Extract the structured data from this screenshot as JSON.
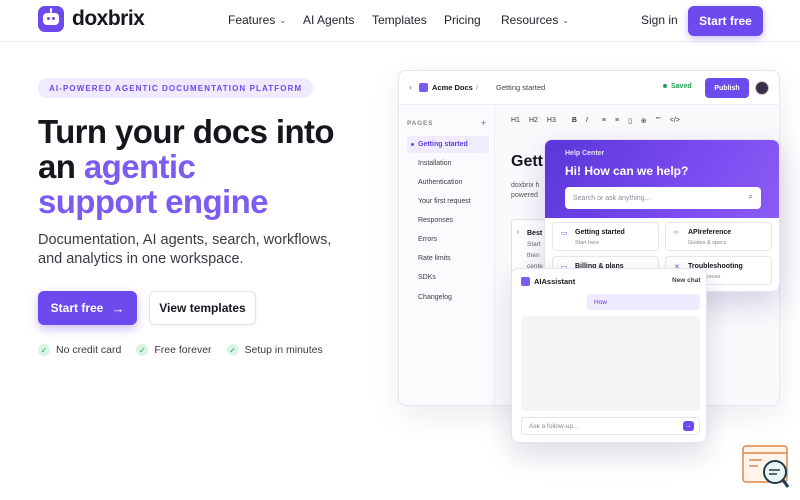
{
  "brand": {
    "name": "doxbrix",
    "accent": "#6d4aed",
    "accent_light": "#7c5cf0"
  },
  "nav": {
    "links": [
      {
        "label": "Features",
        "dropdown": true
      },
      {
        "label": "AI Agents",
        "dropdown": false
      },
      {
        "label": "Templates",
        "dropdown": false
      },
      {
        "label": "Pricing",
        "dropdown": false
      },
      {
        "label": "Resources",
        "dropdown": true
      }
    ],
    "signin": "Sign in",
    "cta": "Start free"
  },
  "hero": {
    "badge": "AI-POWERED AGENTIC DOCUMENTATION PLATFORM",
    "headline_1": "Turn your docs into",
    "headline_2a": "an ",
    "headline_2b": "agentic",
    "headline_3": "support engine",
    "subtitle": "Documentation, AI agents, search, workflows, and analytics in one workspace.",
    "primary_button": "Start free",
    "secondary_button": "View templates",
    "checks": [
      "No credit card",
      "Free forever",
      "Setup in minutes"
    ]
  },
  "editor": {
    "workspace": "Acme Docs",
    "separator": "/",
    "breadcrumb": "Getting started",
    "status": "Saved",
    "publish": "Publish",
    "pages_label": "PAGES",
    "pages": [
      "Getting started",
      "Installation",
      "Authentication",
      "Your first request",
      "Responses",
      "Errors",
      "Rate limits",
      "SDKs",
      "Changelog"
    ],
    "toolbar": [
      "H1",
      "H2",
      "H3",
      "B",
      "I",
      "≡",
      "≡",
      "▯",
      "⊕",
      "\"\"",
      "</>"
    ],
    "doc_title": "Getti",
    "doc_lines": [
      "doxbrix h",
      "powered"
    ],
    "card_title": "Best",
    "card_lines": [
      "Start",
      "then",
      "cente"
    ]
  },
  "help_center": {
    "label": "Help Center",
    "title": "Hi! How can we help?",
    "search_placeholder": "Search or ask anything...",
    "cards": [
      {
        "title": "Getting started",
        "subtitle": "Start here",
        "icon": "doc-icon"
      },
      {
        "title": "APIreference",
        "subtitle": "Guides & specs",
        "icon": "code-icon"
      },
      {
        "title": "Billing & plans",
        "subtitle": "",
        "icon": "card-icon"
      },
      {
        "title": "Troubleshooting",
        "subtitle": "mmon issues",
        "icon": "wrench-icon"
      }
    ]
  },
  "ai_assistant": {
    "title": "AIAssistant",
    "new_chat": "New chat",
    "bubble": "How",
    "input_placeholder": "Ask a follow-up..."
  }
}
